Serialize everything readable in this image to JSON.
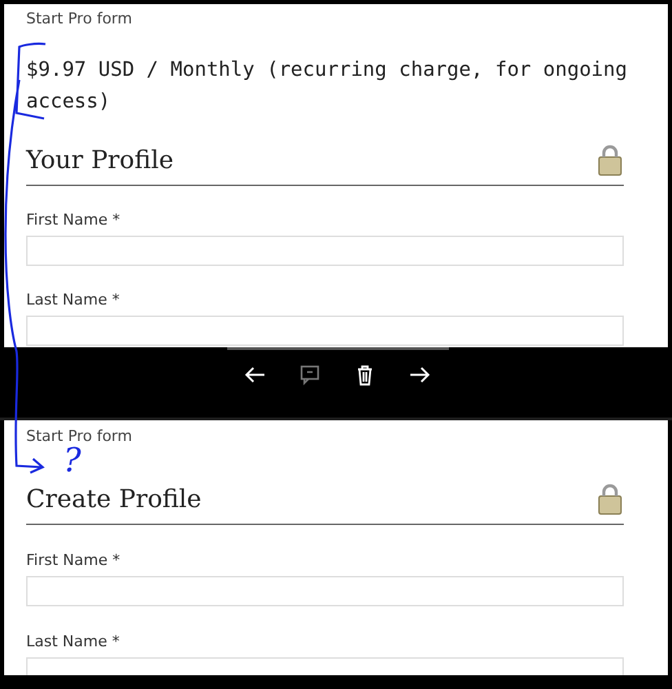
{
  "panels": [
    {
      "form_title": "Start Pro form",
      "price": "$9.97 USD / Monthly (recurring charge, for ongoing access)",
      "heading": "Your Profile",
      "fields": [
        {
          "label": "First Name *"
        },
        {
          "label": "Last Name *"
        }
      ]
    },
    {
      "form_title": "Start Pro form",
      "heading": "Create Profile",
      "fields": [
        {
          "label": "First Name *"
        },
        {
          "label": "Last Name *"
        }
      ]
    }
  ],
  "toolbar": [
    {
      "kind": "back",
      "disabled": false
    },
    {
      "kind": "comment",
      "disabled": true
    },
    {
      "kind": "delete",
      "disabled": false
    },
    {
      "kind": "forward",
      "disabled": false
    }
  ],
  "annotation": {
    "mark": "?"
  }
}
